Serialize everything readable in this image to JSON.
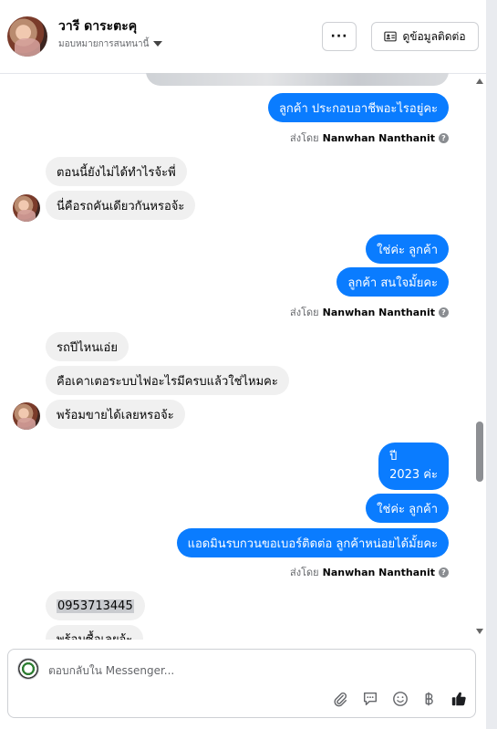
{
  "header": {
    "name": "วารี ดาระตะคุ",
    "subtitle": "มอบหมายการสนทนานี้",
    "more_label": "···",
    "contact_label": "ดูข้อมูลติดต่อ"
  },
  "thread": {
    "messages": [
      {
        "dir": "out",
        "text": "ลูกค้า ประกอบอาชีพอะไรอยู่คะ"
      },
      {
        "dir": "inc",
        "text": "ตอนนี้ยังไม่ได้ทำไรจ้ะพี่"
      },
      {
        "dir": "inc",
        "text": "นี่คือรถคันเดียวกันหรอจ้ะ"
      },
      {
        "dir": "out",
        "text": "ใช่ค่ะ ลูกค้า"
      },
      {
        "dir": "out",
        "text": "ลูกค้า สนใจมั้ยคะ"
      },
      {
        "dir": "inc",
        "text": "รถปีไหนเอ่ย"
      },
      {
        "dir": "inc",
        "text": "คือเคาเตอระบบไฟอะไรมีครบแล้วใช่ไหมคะ"
      },
      {
        "dir": "inc",
        "text": "พร้อมขายได้เลยหรอจ้ะ"
      },
      {
        "dir": "out",
        "line1": "ปี",
        "line2": "2023 ค่ะ"
      },
      {
        "dir": "out",
        "text": "ใช่ค่ะ ลูกค้า"
      },
      {
        "dir": "out",
        "text": "แอดมินรบกวนขอเบอร์ติดต่อ ลูกค้าหน่อยได้มั้ยคะ"
      },
      {
        "dir": "inc",
        "text": "0953713445"
      },
      {
        "dir": "inc",
        "text": "พร้อมซื้อเลยจ้ะ"
      }
    ],
    "sent_by_prefix": "ส่งโดย",
    "sent_by_name": "Nanwhan Nanthanit"
  },
  "composer": {
    "placeholder": "ตอบกลับใน Messenger...",
    "tools": [
      "paperclip-icon",
      "saved-reply-icon",
      "emoji-icon",
      "baht-icon",
      "like-icon"
    ]
  },
  "colors": {
    "outgoing": "#0a7cff",
    "incoming": "#f0f0f0"
  }
}
